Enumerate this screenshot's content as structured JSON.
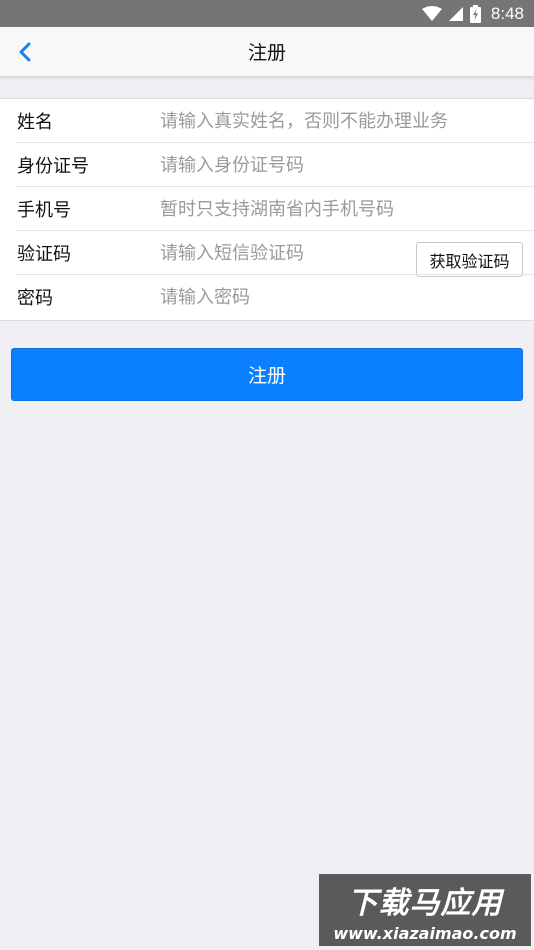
{
  "status_bar": {
    "time": "8:48",
    "icons": [
      "wifi-icon",
      "signal-icon",
      "battery-charging-icon"
    ]
  },
  "nav": {
    "back_icon": "chevron-left-icon",
    "title": "注册",
    "accent_color": "#1a7ff0"
  },
  "form": {
    "rows": [
      {
        "label": "姓名",
        "placeholder": "请输入真实姓名，否则不能办理业务",
        "value": ""
      },
      {
        "label": "身份证号",
        "placeholder": "请输入身份证号码",
        "value": ""
      },
      {
        "label": "手机号",
        "placeholder": "暂时只支持湖南省内手机号码",
        "value": ""
      },
      {
        "label": "验证码",
        "placeholder": "请输入短信验证码",
        "value": ""
      },
      {
        "label": "密码",
        "placeholder": "请输入密码",
        "value": ""
      }
    ],
    "get_code_label": "获取验证码"
  },
  "submit": {
    "label": "注册",
    "color": "#0a80ff"
  },
  "watermark": {
    "title": "下载马应用",
    "url": "www.xiazaimao.com"
  }
}
